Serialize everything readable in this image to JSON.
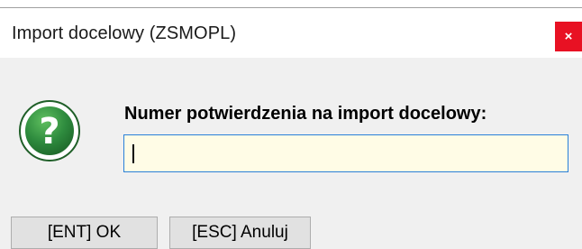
{
  "window": {
    "title": "Import docelowy (ZSMOPL)",
    "close_glyph": "×"
  },
  "dialog": {
    "icon": "question-icon",
    "prompt": "Numer potwierdzenia na import docelowy:",
    "input_value": "",
    "input_bg": "#fffce6"
  },
  "buttons": {
    "ok_label": "[ENT] OK",
    "cancel_label": "[ESC] Anuluj"
  },
  "colors": {
    "close_red": "#e81123",
    "icon_green": "#2e8b3e",
    "input_border": "#2a80d8"
  }
}
